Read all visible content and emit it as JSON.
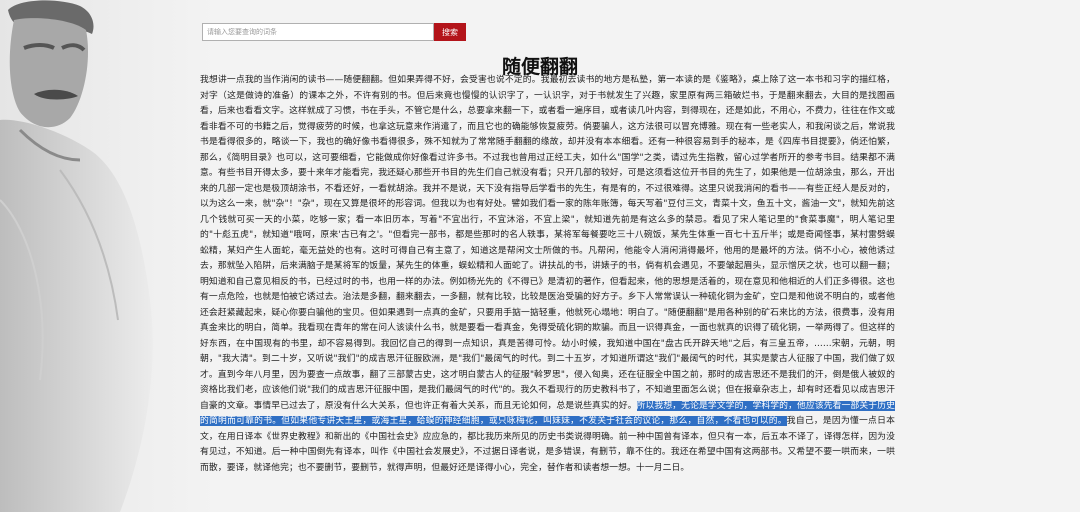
{
  "search": {
    "placeholder": "请输入您要查询的词条",
    "button_label": "搜索"
  },
  "article": {
    "title": "随便翻翻",
    "text_before": "我想讲一点我的当作消闲的读书——随便翻翻。但如果弄得不好，会受害也说不定的。我最初去读书的地方是私塾，第一本读的是《鉴略》，桌上除了这一本书和习字的描红格，对字（这是做诗的准备）的课本之外，不许有别的书。但后来竟也慢慢的认识字了，一认识字，对于书就发生了兴趣，家里原有两三箱破烂书，于是翻来翻去，大目的是找图画看，后来也看看文字。这样就成了习惯，书在手头，不管它是什么，总要拿来翻一下，或者看一遍序目，或者读几叶内容，到得现在，还是如此，不用心，不费力，往往在作文或看非看不可的书籍之后，觉得疲劳的时候，也拿这玩意来作消遣了，而且它也的确能够恢复疲劳。倘要骗人，这方法很可以冒充博雅。现在有一些老实人，和我闲谈之后，常说我书是看得很多的，略谈一下，我也的确好像书看得很多，殊不知就为了常常随手翻翻的缘故，却并没有本本细看。还有一种很容易到手的秘本，是《四库书目提要》，倘还怕繁，那么，《简明目录》也可以，这可要细看，它能做成你好像看过许多书。不过我也曾用过正经工夫，如什么\"国学\"之类，请过先生指教，留心过学者所开的参考书目。结果都不满意。有些书目开得太多，要十来年才能看完，我还疑心那些开书目的先生们自己就没有看；只开几部的较好，可是这须看这位开书目的先生了，如果他是一位胡涂虫，那么，开出来的几部一定也是极顶胡涂书，不看还好，一看就胡涂。我并不是说，天下没有指导后学看书的先生，有是有的，不过很难得。这里只说我消闲的看书——有些正经人是反对的，以为这么一来，就\"杂\"！\"杂\"，现在又算是很坏的形容词。但我以为也有好处。譬如我们看一家的陈年账簿，每天写着\"豆付三文，青菜十文，鱼五十文，酱油一文\"，就知先前这几个钱就可买一天的小菜，吃够一家；看一本旧历本，写着\"不宜出行，不宜沐浴，不宜上梁\"，就知道先前是有这么多的禁忌。看见了宋人笔记里的\"食菜事魔\"，明人笔记里的\"十彪五虎\"，就知道\"哦呵，原来'古已有之'。\"但看完一部书，都是些那时的名人轶事，某将军每餐要吃三十八碗饭，某先生体重一百七十五斤半；或是奇闻怪事，某村雷劈蜈蚣精，某妇产生人面蛇，毫无益处的也有。这时可得自己有主意了，知道这是帮闲文士所做的书。凡帮闲，他能令人消闲消得最坏，他用的是最坏的方法。倘不小心，被他诱过去，那就坠入陷阱，后来满脑子是某将军的饭量，某先生的体重，蜈蚣精和人面蛇了。讲扶乩的书，讲婊子的书，倘有机会遇见，不要皱起眉头，显示憎厌之状，也可以翻一翻；明知道和自己意见相反的书，已经过时的书，也用一样的办法。例如杨光先的《不得已》是清初的著作，但看起来，他的思想是活着的，现在意见和他相近的人们正多得很。这也有一点危险，也就是怕被它诱过去。治法是多翻，翻来翻去，一多翻，就有比较，比较是医治受骗的好方子。乡下人常常误认一种硫化铜为金矿，空口是和他说不明白的，或者他还会赶紧藏起来，疑心你要白骗他的宝贝。但如果遇到一点真的金矿，只要用手掂一掂轻重，他就死心塌地：明白了。\"随便翻翻\"是用各种别的矿石来比的方法，很费事，没有用真金来比的明白，简单。我看现在青年的常在问人该读什么书，就是要看一看真金，免得受硫化铜的欺骗。而且一识得真金，一面也就真的识得了硫化铜，一举两得了。但这样的好东西，在中国现有的书里，却不容易得到。我回忆自己的得到一点知识，真是苦得可怜。幼小时候，我知道中国在\"盘古氏开辟天地\"之后，有三皇五帝，……宋朝，元朝，明朝，\"我大清\"。到二十岁，又听说\"我们\"的成吉思汗征服欧洲，是\"我们\"最阔气的时代。到二十五岁，才知道所谓这\"我们\"最阔气的时代，其实是蒙古人征服了中国，我们做了奴才。直到今年八月里，因为要查一点故事，翻了三部蒙古史，这才明白蒙古人的征服\"斡罗思\"，侵入匈奥，还在征服全中国之前，那时的成吉思还不是我们的汗，倒是俄人被奴的资格比我们老，应该他们说\"我们的成吉思汗征服中国，是我们最阔气的时代\"的。我久不看现行的历史教科书了，不知道里面怎么说；但在报章杂志上，却有时还看见以成吉思汗自豪的文章。事情早已过去了，原没有什么大关系，但也许正有着大关系，而且无论如何，总是说些真实的好。",
    "highlighted": "所以我想，无论是学文学的，学科学的，他应该先看一部关于历史的简明而可靠的书。但如果他专讲天王星，或海王星，蛤蟆的神经细胞，或只咏梅花，叫妹妹，不发关于社会的议论，那么，自然，不看也可以的。",
    "text_after": "我自己，是因为懂一点日本文，在用日译本《世界史教程》和新出的《中国社会史》应应急的，都比我历来所见的历史书类说得明确。前一种中国曾有译本，但只有一本，后五本不译了，译得怎样，因为没有见过，不知道。后一种中国倒先有译本，叫作《中国社会发展史》，不过据日译者说，是多错误，有删节，靠不住的。我还在希望中国有这两部书。又希望不要一哄而来，一哄而散，要译，就译他完；也不要删节，要删节，就得声明，但最好还是译得小心，完全，替作者和读者想一想。十一月二日。"
  }
}
